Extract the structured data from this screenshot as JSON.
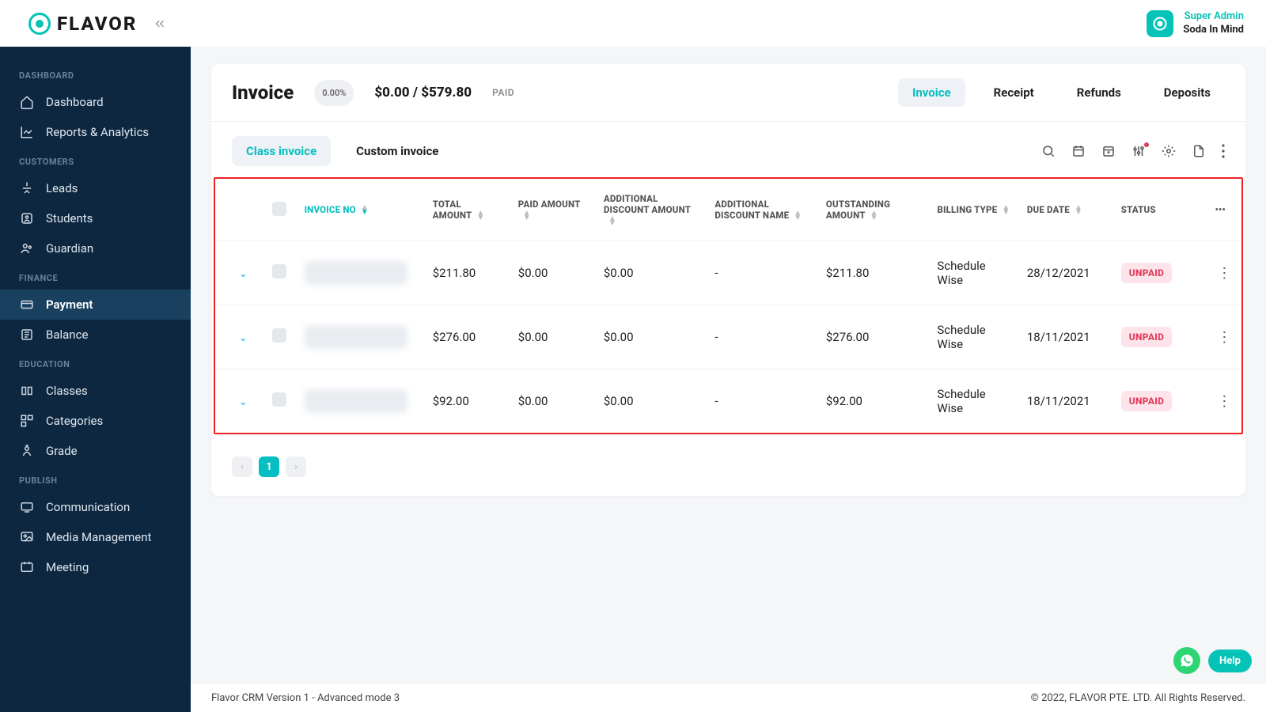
{
  "brand": "FLAVOR",
  "user": {
    "role": "Super Admin",
    "name": "Soda In Mind"
  },
  "sidebar": {
    "sections": [
      {
        "label": "DASHBOARD",
        "items": [
          {
            "icon": "home",
            "label": "Dashboard"
          },
          {
            "icon": "chart",
            "label": "Reports & Analytics"
          }
        ]
      },
      {
        "label": "CUSTOMERS",
        "items": [
          {
            "icon": "leads",
            "label": "Leads"
          },
          {
            "icon": "students",
            "label": "Students"
          },
          {
            "icon": "guardian",
            "label": "Guardian"
          }
        ]
      },
      {
        "label": "FINANCE",
        "items": [
          {
            "icon": "payment",
            "label": "Payment",
            "active": true
          },
          {
            "icon": "balance",
            "label": "Balance"
          }
        ]
      },
      {
        "label": "EDUCATION",
        "items": [
          {
            "icon": "classes",
            "label": "Classes"
          },
          {
            "icon": "categories",
            "label": "Categories"
          },
          {
            "icon": "grade",
            "label": "Grade"
          }
        ]
      },
      {
        "label": "PUBLISH",
        "items": [
          {
            "icon": "communication",
            "label": "Communication"
          },
          {
            "icon": "media",
            "label": "Media Management"
          },
          {
            "icon": "meeting",
            "label": "Meeting"
          }
        ]
      }
    ]
  },
  "page": {
    "title": "Invoice",
    "percent": "0.00%",
    "amount": "$0.00 / $579.80",
    "status": "PAID",
    "tabs": [
      "Invoice",
      "Receipt",
      "Refunds",
      "Deposits"
    ],
    "subtabs": [
      "Class invoice",
      "Custom invoice"
    ]
  },
  "table": {
    "columns": [
      "INVOICE NO",
      "TOTAL AMOUNT",
      "PAID AMOUNT",
      "ADDITIONAL DISCOUNT AMOUNT",
      "ADDITIONAL DISCOUNT NAME",
      "OUTSTANDING AMOUNT",
      "BILLING TYPE",
      "DUE DATE",
      "STATUS"
    ],
    "rows": [
      {
        "total": "$211.80",
        "paid": "$0.00",
        "addl_amount": "$0.00",
        "addl_name": "-",
        "outstanding": "$211.80",
        "billing": "Schedule Wise",
        "due": "28/12/2021",
        "status": "UNPAID"
      },
      {
        "total": "$276.00",
        "paid": "$0.00",
        "addl_amount": "$0.00",
        "addl_name": "-",
        "outstanding": "$276.00",
        "billing": "Schedule Wise",
        "due": "18/11/2021",
        "status": "UNPAID"
      },
      {
        "total": "$92.00",
        "paid": "$0.00",
        "addl_amount": "$0.00",
        "addl_name": "-",
        "outstanding": "$92.00",
        "billing": "Schedule Wise",
        "due": "18/11/2021",
        "status": "UNPAID"
      }
    ]
  },
  "pagination": {
    "current": "1"
  },
  "footer": {
    "left": "Flavor CRM Version 1 - Advanced mode 3",
    "right": "© 2022, FLAVOR PTE. LTD. All Rights Reserved."
  },
  "help": "Help"
}
